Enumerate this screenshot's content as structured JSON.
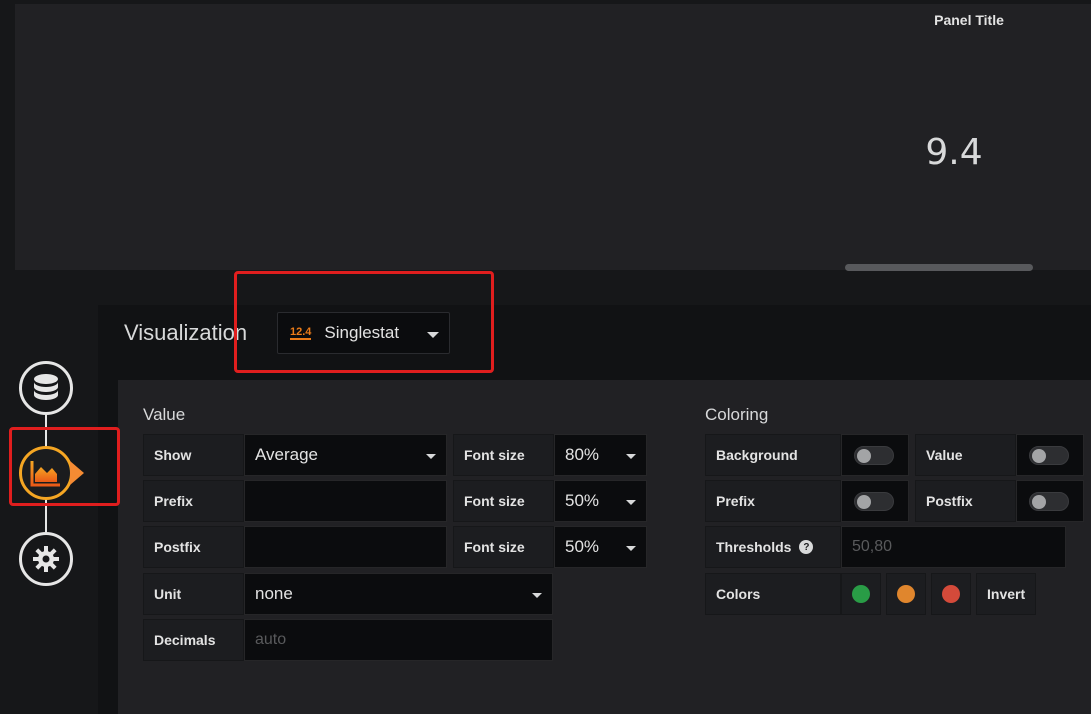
{
  "panel": {
    "title": "Panel Title",
    "value": "9.4"
  },
  "steps": [
    {
      "name": "queries",
      "icon": "database-icon"
    },
    {
      "name": "visualization",
      "icon": "area-chart-icon",
      "active": true
    },
    {
      "name": "general",
      "icon": "gear-icon"
    }
  ],
  "visualization": {
    "label": "Visualization",
    "picker_logo": "12.4",
    "picker_name": "Singlestat"
  },
  "value_section": {
    "heading": "Value",
    "show": {
      "label": "Show",
      "value": "Average"
    },
    "prefix": {
      "label": "Prefix",
      "value": ""
    },
    "postfix": {
      "label": "Postfix",
      "value": ""
    },
    "unit": {
      "label": "Unit",
      "value": "none"
    },
    "decimals": {
      "label": "Decimals",
      "placeholder": "auto"
    },
    "font_sizes": [
      {
        "label": "Font size",
        "value": "80%"
      },
      {
        "label": "Font size",
        "value": "50%"
      },
      {
        "label": "Font size",
        "value": "50%"
      }
    ]
  },
  "coloring": {
    "heading": "Coloring",
    "background": {
      "label": "Background",
      "on": false
    },
    "value": {
      "label": "Value",
      "on": false
    },
    "prefix": {
      "label": "Prefix",
      "on": false
    },
    "postfix": {
      "label": "Postfix",
      "on": false
    },
    "thresholds": {
      "label": "Thresholds",
      "placeholder": "50,80",
      "help": "?"
    },
    "colors": {
      "label": "Colors",
      "swatches": [
        "#299c46",
        "#e0862d",
        "#d44a3a"
      ],
      "invert_label": "Invert"
    }
  },
  "colors": {
    "accent": "#f58b33",
    "highlight": "#e01e1e"
  }
}
